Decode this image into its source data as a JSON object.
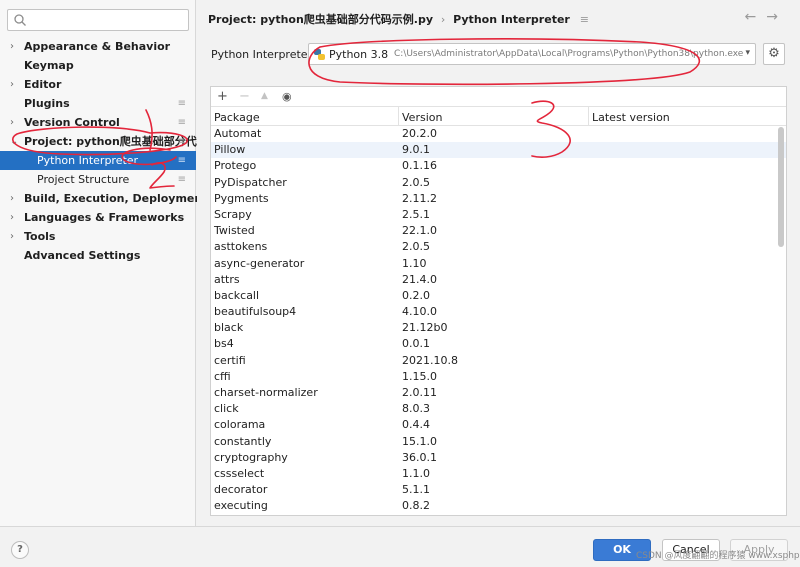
{
  "sidebar": {
    "search_placeholder": "",
    "items": [
      {
        "label": "Appearance & Behavior",
        "arrow": "›",
        "badge": ""
      },
      {
        "label": "Keymap",
        "arrow": "",
        "badge": ""
      },
      {
        "label": "Editor",
        "arrow": "›",
        "badge": ""
      },
      {
        "label": "Plugins",
        "arrow": "",
        "badge": "≡"
      },
      {
        "label": "Version Control",
        "arrow": "›",
        "badge": "≡"
      },
      {
        "label": "Project: python爬虫基础部分代码",
        "arrow": "⌄",
        "badge": "≡"
      },
      {
        "label": "Python Interpreter",
        "arrow": "",
        "badge": "≡"
      },
      {
        "label": "Project Structure",
        "arrow": "",
        "badge": "≡"
      },
      {
        "label": "Build, Execution, Deployment",
        "arrow": "›",
        "badge": ""
      },
      {
        "label": "Languages & Frameworks",
        "arrow": "›",
        "badge": ""
      },
      {
        "label": "Tools",
        "arrow": "›",
        "badge": ""
      },
      {
        "label": "Advanced Settings",
        "arrow": "",
        "badge": ""
      }
    ]
  },
  "header": {
    "crumb_project": "Project: python爬虫基础部分代码示例.py",
    "crumb_sep": "›",
    "crumb_page": "Python Interpreter",
    "badge": "≡",
    "back": "←",
    "forward": "→"
  },
  "interpreter": {
    "label": "Python Interpreter:",
    "name": "Python 3.8",
    "path": "C:\\Users\\Administrator\\AppData\\Local\\Programs\\Python\\Python38\\python.exe",
    "dropdown_icon": "▾",
    "gear_icon": "⚙"
  },
  "toolbar": {
    "add": "+",
    "remove": "−",
    "up": "▲",
    "eye": "◉"
  },
  "columns": {
    "package": "Package",
    "version": "Version",
    "latest": "Latest version"
  },
  "packages": [
    {
      "name": "Automat",
      "version": "20.2.0"
    },
    {
      "name": "Pillow",
      "version": "9.0.1"
    },
    {
      "name": "Protego",
      "version": "0.1.16"
    },
    {
      "name": "PyDispatcher",
      "version": "2.0.5"
    },
    {
      "name": "Pygments",
      "version": "2.11.2"
    },
    {
      "name": "Scrapy",
      "version": "2.5.1"
    },
    {
      "name": "Twisted",
      "version": "22.1.0"
    },
    {
      "name": "asttokens",
      "version": "2.0.5"
    },
    {
      "name": "async-generator",
      "version": "1.10"
    },
    {
      "name": "attrs",
      "version": "21.4.0"
    },
    {
      "name": "backcall",
      "version": "0.2.0"
    },
    {
      "name": "beautifulsoup4",
      "version": "4.10.0"
    },
    {
      "name": "black",
      "version": "21.12b0"
    },
    {
      "name": "bs4",
      "version": "0.0.1"
    },
    {
      "name": "certifi",
      "version": "2021.10.8"
    },
    {
      "name": "cffi",
      "version": "1.15.0"
    },
    {
      "name": "charset-normalizer",
      "version": "2.0.11"
    },
    {
      "name": "click",
      "version": "8.0.3"
    },
    {
      "name": "colorama",
      "version": "0.4.4"
    },
    {
      "name": "constantly",
      "version": "15.1.0"
    },
    {
      "name": "cryptography",
      "version": "36.0.1"
    },
    {
      "name": "cssselect",
      "version": "1.1.0"
    },
    {
      "name": "decorator",
      "version": "5.1.1"
    },
    {
      "name": "executing",
      "version": "0.8.2"
    }
  ],
  "footer": {
    "help": "?",
    "ok": "OK",
    "cancel": "Cancel",
    "apply": "Apply",
    "watermark": "CSDN @风度翩翩的程序猿 www.xsphp.online"
  },
  "annotations": {
    "one": "1",
    "two": "2",
    "three": "3",
    "color": "#e3263b"
  }
}
